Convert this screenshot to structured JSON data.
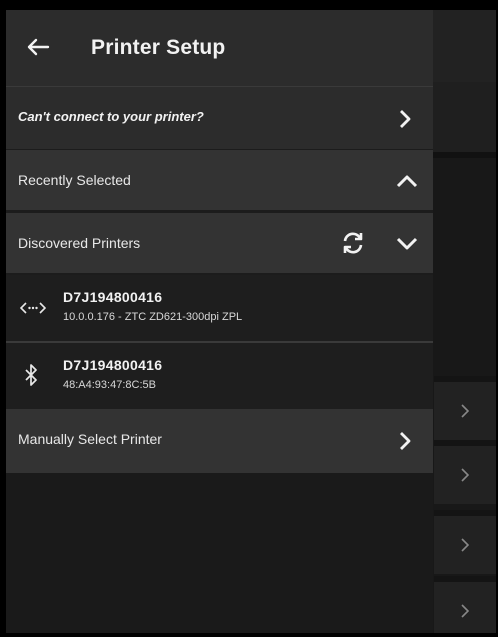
{
  "header": {
    "title": "Printer Setup",
    "back_icon": "arrow-left-icon"
  },
  "help_row": {
    "label": "Can't connect to your printer?",
    "icon": "chevron-right-icon"
  },
  "sections": {
    "recent": {
      "label": "Recently Selected",
      "state": "expanded"
    },
    "discovered": {
      "label": "Discovered Printers",
      "state": "collapsed",
      "refresh_icon": "refresh-icon"
    }
  },
  "printers": [
    {
      "name": "D7J194800416",
      "detail": "10.0.0.176 - ZTC ZD621-300dpi ZPL",
      "connection_icon": "network-icon"
    },
    {
      "name": "D7J194800416",
      "detail": "48:A4:93:47:8C:5B",
      "connection_icon": "bluetooth-icon"
    }
  ],
  "manual": {
    "label": "Manually Select Printer",
    "icon": "chevron-right-icon"
  },
  "colors": {
    "panel": "#2c2c2c",
    "section": "#333333",
    "row": "#1e1e1e",
    "text": "#f2f2f2"
  }
}
